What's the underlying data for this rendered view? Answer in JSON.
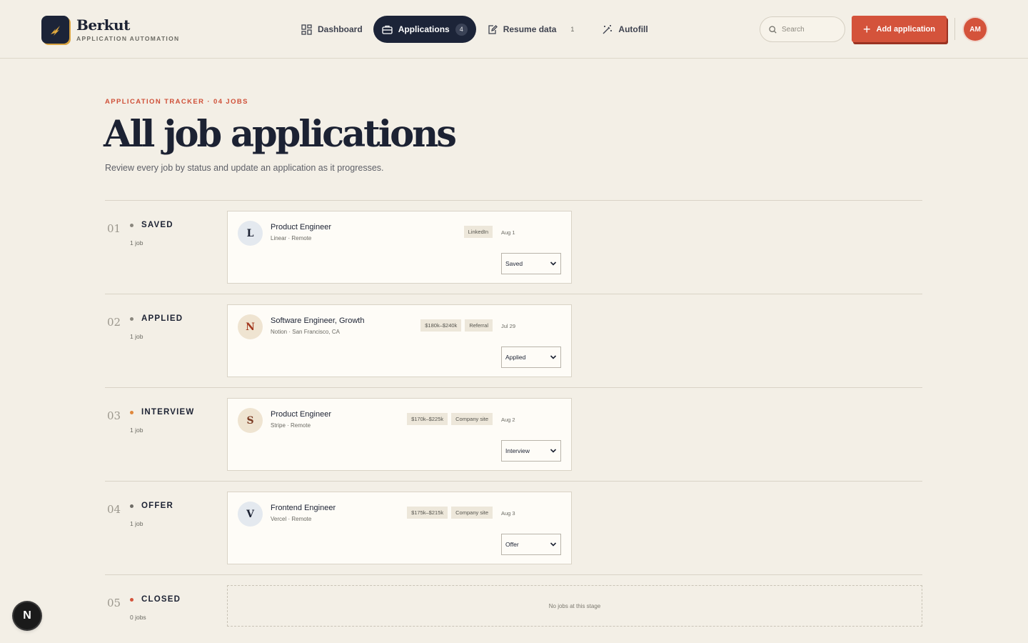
{
  "brand": {
    "name": "Berkut",
    "tagline": "APPLICATION AUTOMATION"
  },
  "nav": {
    "items": [
      {
        "label": "Dashboard",
        "icon": "dashboard-icon"
      },
      {
        "label": "Applications",
        "icon": "briefcase-icon",
        "badge": "4",
        "active": true
      },
      {
        "label": "Resume data",
        "icon": "edit-document-icon",
        "badge": "1"
      },
      {
        "label": "Autofill",
        "icon": "magic-wand-icon"
      }
    ]
  },
  "search": {
    "placeholder": "Search"
  },
  "actions": {
    "add_label": "Add application"
  },
  "user": {
    "initials": "AM"
  },
  "hero": {
    "eyebrow": "APPLICATION TRACKER · 04 JOBS",
    "title": "All job applications",
    "subtitle": "Review every job by status and update an application as it progresses."
  },
  "stages": [
    {
      "num": "01",
      "name": "SAVED",
      "count": "1 job",
      "dot_color": "#8a877e",
      "job": {
        "logo_letter": "L",
        "logo_bg": "#e4e9ef",
        "logo_fg": "#1c2233",
        "title": "Product Engineer",
        "meta": "Linear · Remote",
        "tags": [
          "LinkedIn"
        ],
        "date": "Aug 1",
        "status": "Saved"
      }
    },
    {
      "num": "02",
      "name": "APPLIED",
      "count": "1 job",
      "dot_color": "#8a877e",
      "job": {
        "logo_letter": "N",
        "logo_bg": "#efe4d1",
        "logo_fg": "#a3391f",
        "title": "Software Engineer, Growth",
        "meta": "Notion · San Francisco, CA",
        "tags": [
          "$180k–$240k",
          "Referral"
        ],
        "date": "Jul 29",
        "status": "Applied"
      }
    },
    {
      "num": "03",
      "name": "INTERVIEW",
      "count": "1 job",
      "dot_color": "#e0883c",
      "job": {
        "logo_letter": "S",
        "logo_bg": "#efe4d1",
        "logo_fg": "#7a3a22",
        "title": "Product Engineer",
        "meta": "Stripe · Remote",
        "tags": [
          "$170k–$225k",
          "Company site"
        ],
        "date": "Aug 2",
        "status": "Interview"
      }
    },
    {
      "num": "04",
      "name": "OFFER",
      "count": "1 job",
      "dot_color": "#6e6c66",
      "job": {
        "logo_letter": "V",
        "logo_bg": "#e4e9ef",
        "logo_fg": "#1c2233",
        "title": "Frontend Engineer",
        "meta": "Vercel · Remote",
        "tags": [
          "$175k–$215k",
          "Company site"
        ],
        "date": "Aug 3",
        "status": "Offer"
      }
    },
    {
      "num": "05",
      "name": "CLOSED",
      "count": "0 jobs",
      "dot_color": "#d4533b",
      "empty_text": "No jobs at this stage"
    }
  ],
  "dev_badge": {
    "letter": "N"
  }
}
